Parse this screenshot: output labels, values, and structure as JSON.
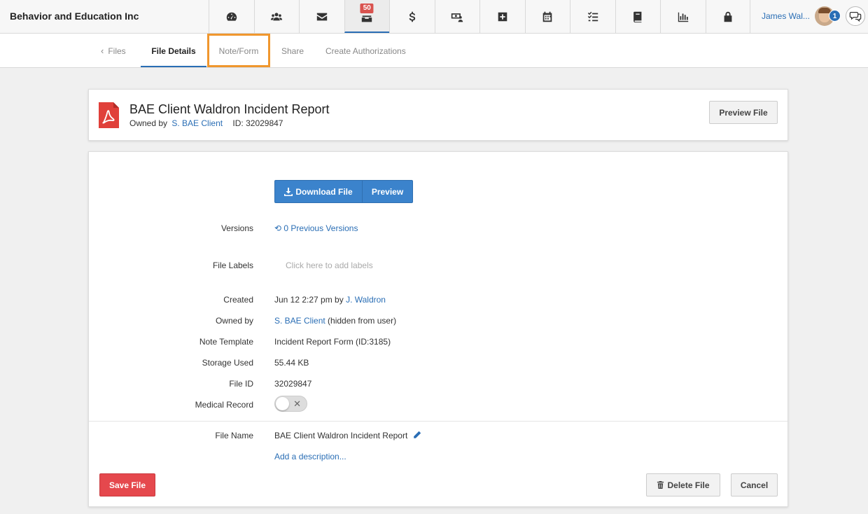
{
  "brand": "Behavior and Education Inc",
  "nav": {
    "badge_count": "50",
    "user_name": "James Wal...",
    "user_badge": "1"
  },
  "subnav": {
    "back": "Files",
    "tabs": [
      "File Details",
      "Note/Form",
      "Share",
      "Create Authorizations"
    ]
  },
  "header": {
    "title": "BAE Client Waldron Incident Report",
    "owned_by_label": "Owned by",
    "owner": "S. BAE Client",
    "id_text": "ID: 32029847",
    "preview_button": "Preview File"
  },
  "actions": {
    "download": "Download File",
    "preview": "Preview"
  },
  "details": {
    "versions_label": "Versions",
    "versions_value": "0 Previous Versions",
    "labels_label": "File Labels",
    "labels_placeholder": "Click here to add labels",
    "created_label": "Created",
    "created_value": "Jun 12 2:27 pm by",
    "created_by": "J. Waldron",
    "owned_label": "Owned by",
    "owned_value": "S. BAE Client",
    "owned_suffix": "(hidden from user)",
    "template_label": "Note Template",
    "template_value": "Incident Report Form (ID:3185)",
    "storage_label": "Storage Used",
    "storage_value": "55.44 KB",
    "fileid_label": "File ID",
    "fileid_value": "32029847",
    "medical_label": "Medical Record",
    "medical_on": false,
    "filename_label": "File Name",
    "filename_value": "BAE Client Waldron Incident Report",
    "description_link": "Add a description..."
  },
  "footer": {
    "save": "Save File",
    "delete": "Delete File",
    "cancel": "Cancel"
  },
  "colors": {
    "accent": "#2a6eb5",
    "primary_button": "#3b83cc",
    "danger": "#e5484d",
    "highlight": "#f0972e"
  }
}
